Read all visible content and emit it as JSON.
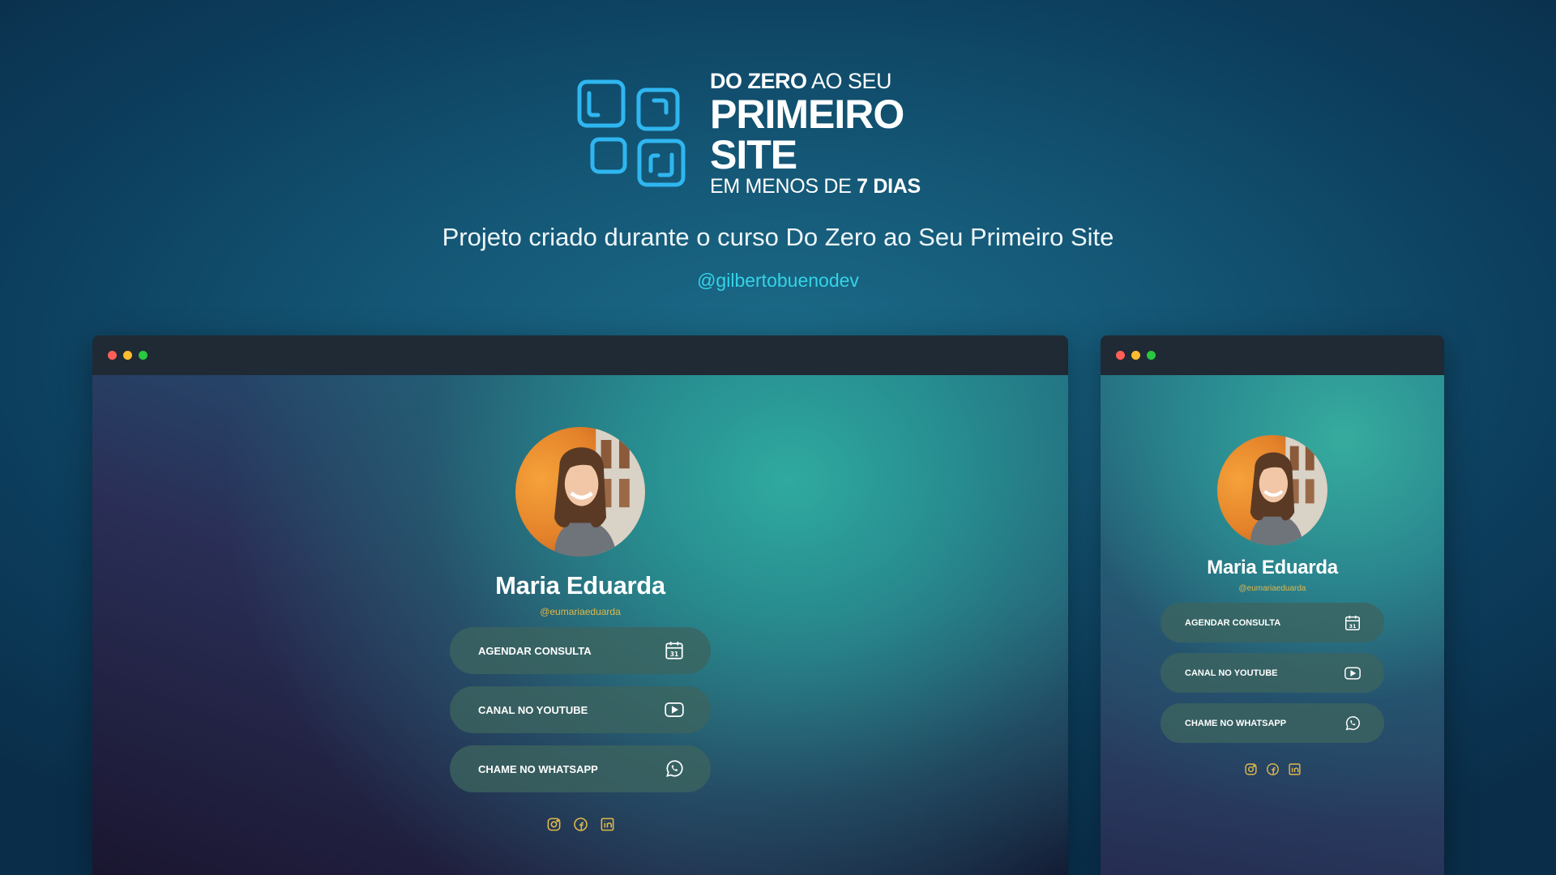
{
  "logo": {
    "line1_bold": "DO ZERO",
    "line1_rest": " AO SEU",
    "line2": "PRIMEIRO SITE",
    "line3_rest": "EM MENOS DE ",
    "line3_bold": "7 DIAS"
  },
  "subtitle": "Projeto criado durante o curso Do Zero ao Seu Primeiro Site",
  "author_handle": "@gilbertobuenodev",
  "colors": {
    "accent_cyan": "#35d3e6",
    "logo_blue": "#2fb6f0",
    "gold": "#e0b84a",
    "dot_red": "#ff5f57",
    "dot_yellow": "#febc2e",
    "dot_green": "#28c840"
  },
  "profile": {
    "name": "Maria Eduarda",
    "username": "@eumariaeduarda",
    "links": [
      {
        "label": "AGENDAR CONSULTA",
        "icon": "calendar-icon"
      },
      {
        "label": "CANAL NO YOUTUBE",
        "icon": "play-icon"
      },
      {
        "label": "CHAME NO WHATSAPP",
        "icon": "whatsapp-icon"
      }
    ],
    "socials": [
      "instagram-icon",
      "facebook-icon",
      "linkedin-icon"
    ]
  }
}
